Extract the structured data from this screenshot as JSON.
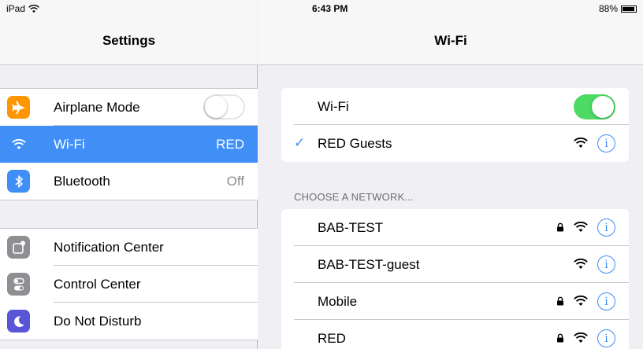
{
  "status_bar": {
    "device": "iPad",
    "time": "6:43 PM",
    "battery": "88%",
    "battery_level": 0.88
  },
  "left": {
    "title": "Settings",
    "group1": [
      {
        "label": "Airplane Mode",
        "icon": "airplane-icon",
        "color": "#ff9500",
        "toggle": false
      },
      {
        "label": "Wi-Fi",
        "icon": "wifi-icon",
        "color": "#3f8ff7",
        "value": "RED",
        "selected": true
      },
      {
        "label": "Bluetooth",
        "icon": "bluetooth-icon",
        "color": "#3f8ff7",
        "value": "Off"
      }
    ],
    "group2": [
      {
        "label": "Notification Center",
        "icon": "notification-center-icon",
        "color": "#8e8e93"
      },
      {
        "label": "Control Center",
        "icon": "control-center-icon",
        "color": "#8e8e93"
      },
      {
        "label": "Do Not Disturb",
        "icon": "moon-icon",
        "color": "#5856d6"
      }
    ]
  },
  "right": {
    "title": "Wi-Fi",
    "wifi_toggle_label": "Wi-Fi",
    "wifi_enabled": true,
    "connected_network": "RED Guests",
    "section_header": "CHOOSE A NETWORK...",
    "networks": [
      {
        "name": "BAB-TEST",
        "secured": true
      },
      {
        "name": "BAB-TEST-guest",
        "secured": false
      },
      {
        "name": "Mobile",
        "secured": true
      },
      {
        "name": "RED",
        "secured": true
      }
    ],
    "info_glyph": "i"
  },
  "colors": {
    "accent": "#3f8ff7",
    "toggle_on": "#4cd964",
    "background": "#efeff4"
  }
}
